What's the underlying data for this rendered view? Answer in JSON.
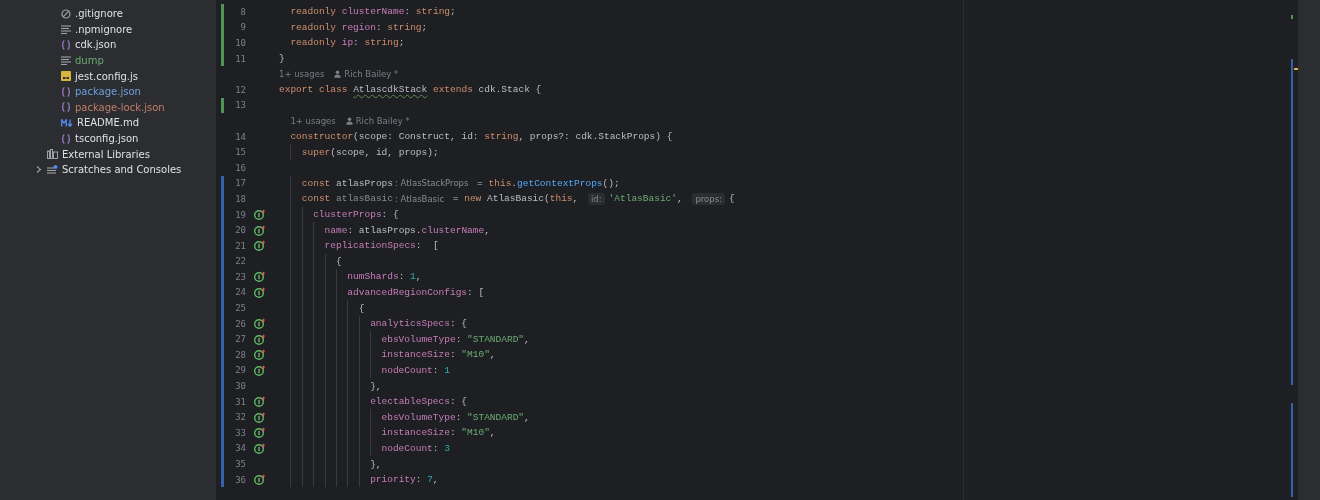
{
  "project_tree": {
    "items": [
      {
        "name": ".gitignore",
        "kind": "ignore"
      },
      {
        "name": ".npmignore",
        "kind": "text"
      },
      {
        "name": "cdk.json",
        "kind": "json"
      },
      {
        "name": "dump",
        "kind": "text",
        "color": "#6aab73"
      },
      {
        "name": "jest.config.js",
        "kind": "js"
      },
      {
        "name": "package.json",
        "kind": "json",
        "color": "#6f9fe0"
      },
      {
        "name": "package-lock.json",
        "kind": "json",
        "color": "#c27d6b"
      },
      {
        "name": "README.md",
        "kind": "markdown"
      },
      {
        "name": "tsconfig.json",
        "kind": "json"
      }
    ],
    "roots": [
      {
        "name": "External Libraries",
        "kind": "library"
      },
      {
        "name": "Scratches and Consoles",
        "kind": "scratch",
        "expanded": false
      }
    ]
  },
  "editor": {
    "rows": [
      {
        "kind": "code",
        "number": "8",
        "color": "#549159",
        "gutter_icon": false,
        "tokens": [
          {
            "kind": "kw",
            "text": "  readonly "
          },
          {
            "kind": "field",
            "text": "clusterName"
          },
          {
            "kind": "plain",
            "text": ": "
          },
          {
            "kind": "kw",
            "text": "string"
          },
          {
            "kind": "plain",
            "text": ";"
          }
        ]
      },
      {
        "kind": "code",
        "number": "9",
        "color": "#549159",
        "gutter_icon": false,
        "tokens": [
          {
            "kind": "kw",
            "text": "  readonly "
          },
          {
            "kind": "field",
            "text": "region"
          },
          {
            "kind": "plain",
            "text": ": "
          },
          {
            "kind": "kw",
            "text": "string"
          },
          {
            "kind": "plain",
            "text": ";"
          }
        ]
      },
      {
        "kind": "code",
        "number": "10",
        "color": "#549159",
        "gutter_icon": false,
        "tokens": [
          {
            "kind": "kw",
            "text": "  readonly "
          },
          {
            "kind": "field",
            "text": "ip"
          },
          {
            "kind": "plain",
            "text": ": "
          },
          {
            "kind": "kw",
            "text": "string"
          },
          {
            "kind": "plain",
            "text": ";"
          }
        ]
      },
      {
        "kind": "code",
        "number": "11",
        "color": "#549159",
        "gutter_icon": false,
        "tokens": [
          {
            "kind": "plain",
            "text": "}"
          }
        ]
      },
      {
        "kind": "usages",
        "usages": "1+ usages",
        "author": "Rich Bailey *"
      },
      {
        "kind": "code",
        "number": "12",
        "gutter_icon": false,
        "tokens": [
          {
            "kind": "kw",
            "text": "export class "
          },
          {
            "kind": "warn",
            "text": "AtlascdkStack"
          },
          {
            "kind": "kw",
            "text": " extends "
          },
          {
            "kind": "plain",
            "text": "cdk.Stack {"
          }
        ]
      },
      {
        "kind": "code",
        "number": "13",
        "color": "#549159",
        "gutter_icon": false,
        "tokens": []
      },
      {
        "kind": "usages",
        "usages": "  1+ usages",
        "author": "Rich Bailey *"
      },
      {
        "kind": "code",
        "number": "14",
        "gutter_icon": false,
        "tokens": [
          {
            "kind": "kw",
            "text": "  constructor"
          },
          {
            "kind": "plain",
            "text": "(scope: Construct, id: "
          },
          {
            "kind": "kw",
            "text": "string"
          },
          {
            "kind": "plain",
            "text": ", props?: cdk.StackProps) {"
          }
        ]
      },
      {
        "kind": "code",
        "number": "15",
        "gutter_icon": false,
        "tokens": [
          {
            "kind": "kw",
            "text": "    super"
          },
          {
            "kind": "plain",
            "text": "(scope, id, props);"
          }
        ]
      },
      {
        "kind": "code",
        "number": "16",
        "gutter_icon": false,
        "tokens": []
      },
      {
        "kind": "code",
        "number": "17",
        "color": "#375fad",
        "gutter_icon": false,
        "tokens": [
          {
            "kind": "kw",
            "text": "    const "
          },
          {
            "kind": "plain",
            "text": "atlasProps"
          },
          {
            "kind": "hint",
            "text": ": AtlasStackProps"
          },
          {
            "kind": "plain",
            "text": " = "
          },
          {
            "kind": "kw",
            "text": "this"
          },
          {
            "kind": "plain",
            "text": "."
          },
          {
            "kind": "method",
            "text": "getContextProps"
          },
          {
            "kind": "plain",
            "text": "();"
          }
        ]
      },
      {
        "kind": "code",
        "number": "18",
        "color": "#375fad",
        "gutter_icon": false,
        "tokens": [
          {
            "kind": "kw",
            "text": "    const "
          },
          {
            "kind": "unused",
            "text": "atlasBasic"
          },
          {
            "kind": "hint",
            "text": ": AtlasBasic"
          },
          {
            "kind": "plain",
            "text": " = "
          },
          {
            "kind": "kw",
            "text": "new "
          },
          {
            "kind": "plain",
            "text": "AtlasBasic("
          },
          {
            "kind": "kw",
            "text": "this"
          },
          {
            "kind": "plain",
            "text": ", "
          },
          {
            "kind": "param",
            "text": "id:"
          },
          {
            "kind": "string",
            "text": "'AtlasBasic'"
          },
          {
            "kind": "plain",
            "text": ", "
          },
          {
            "kind": "param",
            "text": "props:"
          },
          {
            "kind": "plain",
            "text": "{"
          }
        ]
      },
      {
        "kind": "code",
        "number": "19",
        "color": "#375fad",
        "gutter_icon": true,
        "tokens": [
          {
            "kind": "field",
            "text": "      clusterProps"
          },
          {
            "kind": "plain",
            "text": ": {"
          }
        ]
      },
      {
        "kind": "code",
        "number": "20",
        "color": "#375fad",
        "gutter_icon": true,
        "tokens": [
          {
            "kind": "field",
            "text": "        name"
          },
          {
            "kind": "plain",
            "text": ": atlasProps."
          },
          {
            "kind": "field",
            "text": "clusterName"
          },
          {
            "kind": "plain",
            "text": ","
          }
        ]
      },
      {
        "kind": "code",
        "number": "21",
        "color": "#375fad",
        "gutter_icon": true,
        "tokens": [
          {
            "kind": "field",
            "text": "        replicationSpecs"
          },
          {
            "kind": "plain",
            "text": ":  ["
          }
        ]
      },
      {
        "kind": "code",
        "number": "22",
        "color": "#375fad",
        "gutter_icon": false,
        "tokens": [
          {
            "kind": "plain",
            "text": "          {"
          }
        ]
      },
      {
        "kind": "code",
        "number": "23",
        "color": "#375fad",
        "gutter_icon": true,
        "tokens": [
          {
            "kind": "field",
            "text": "            numShards"
          },
          {
            "kind": "plain",
            "text": ": "
          },
          {
            "kind": "number",
            "text": "1"
          },
          {
            "kind": "plain",
            "text": ","
          }
        ]
      },
      {
        "kind": "code",
        "number": "24",
        "color": "#375fad",
        "gutter_icon": true,
        "tokens": [
          {
            "kind": "field",
            "text": "            advancedRegionConfigs"
          },
          {
            "kind": "plain",
            "text": ": ["
          }
        ]
      },
      {
        "kind": "code",
        "number": "25",
        "color": "#375fad",
        "gutter_icon": false,
        "tokens": [
          {
            "kind": "plain",
            "text": "              {"
          }
        ]
      },
      {
        "kind": "code",
        "number": "26",
        "color": "#375fad",
        "gutter_icon": true,
        "tokens": [
          {
            "kind": "field",
            "text": "                analyticsSpecs"
          },
          {
            "kind": "plain",
            "text": ": {"
          }
        ]
      },
      {
        "kind": "code",
        "number": "27",
        "color": "#375fad",
        "gutter_icon": true,
        "tokens": [
          {
            "kind": "field",
            "text": "                  ebsVolumeType"
          },
          {
            "kind": "plain",
            "text": ": "
          },
          {
            "kind": "string",
            "text": "\"STANDARD\""
          },
          {
            "kind": "plain",
            "text": ","
          }
        ]
      },
      {
        "kind": "code",
        "number": "28",
        "color": "#375fad",
        "gutter_icon": true,
        "tokens": [
          {
            "kind": "field",
            "text": "                  instanceSize"
          },
          {
            "kind": "plain",
            "text": ": "
          },
          {
            "kind": "string",
            "text": "\"M10\""
          },
          {
            "kind": "plain",
            "text": ","
          }
        ]
      },
      {
        "kind": "code",
        "number": "29",
        "color": "#375fad",
        "gutter_icon": true,
        "tokens": [
          {
            "kind": "field",
            "text": "                  nodeCount"
          },
          {
            "kind": "plain",
            "text": ": "
          },
          {
            "kind": "number",
            "text": "1"
          }
        ]
      },
      {
        "kind": "code",
        "number": "30",
        "color": "#375fad",
        "gutter_icon": false,
        "tokens": [
          {
            "kind": "plain",
            "text": "                },"
          }
        ]
      },
      {
        "kind": "code",
        "number": "31",
        "color": "#375fad",
        "gutter_icon": true,
        "tokens": [
          {
            "kind": "field",
            "text": "                electableSpecs"
          },
          {
            "kind": "plain",
            "text": ": {"
          }
        ]
      },
      {
        "kind": "code",
        "number": "32",
        "color": "#375fad",
        "gutter_icon": true,
        "tokens": [
          {
            "kind": "field",
            "text": "                  ebsVolumeType"
          },
          {
            "kind": "plain",
            "text": ": "
          },
          {
            "kind": "string",
            "text": "\"STANDARD\""
          },
          {
            "kind": "plain",
            "text": ","
          }
        ]
      },
      {
        "kind": "code",
        "number": "33",
        "color": "#375fad",
        "gutter_icon": true,
        "tokens": [
          {
            "kind": "field",
            "text": "                  instanceSize"
          },
          {
            "kind": "plain",
            "text": ": "
          },
          {
            "kind": "string",
            "text": "\"M10\""
          },
          {
            "kind": "plain",
            "text": ","
          }
        ]
      },
      {
        "kind": "code",
        "number": "34",
        "color": "#375fad",
        "gutter_icon": true,
        "tokens": [
          {
            "kind": "field",
            "text": "                  nodeCount"
          },
          {
            "kind": "plain",
            "text": ": "
          },
          {
            "kind": "number",
            "text": "3"
          }
        ]
      },
      {
        "kind": "code",
        "number": "35",
        "color": "#375fad",
        "gutter_icon": false,
        "tokens": [
          {
            "kind": "plain",
            "text": "                },"
          }
        ]
      },
      {
        "kind": "code",
        "number": "36",
        "color": "#375fad",
        "gutter_icon": true,
        "tokens": [
          {
            "kind": "field",
            "text": "                priority"
          },
          {
            "kind": "plain",
            "text": ": "
          },
          {
            "kind": "number",
            "text": "7"
          },
          {
            "kind": "plain",
            "text": ","
          }
        ]
      }
    ]
  }
}
